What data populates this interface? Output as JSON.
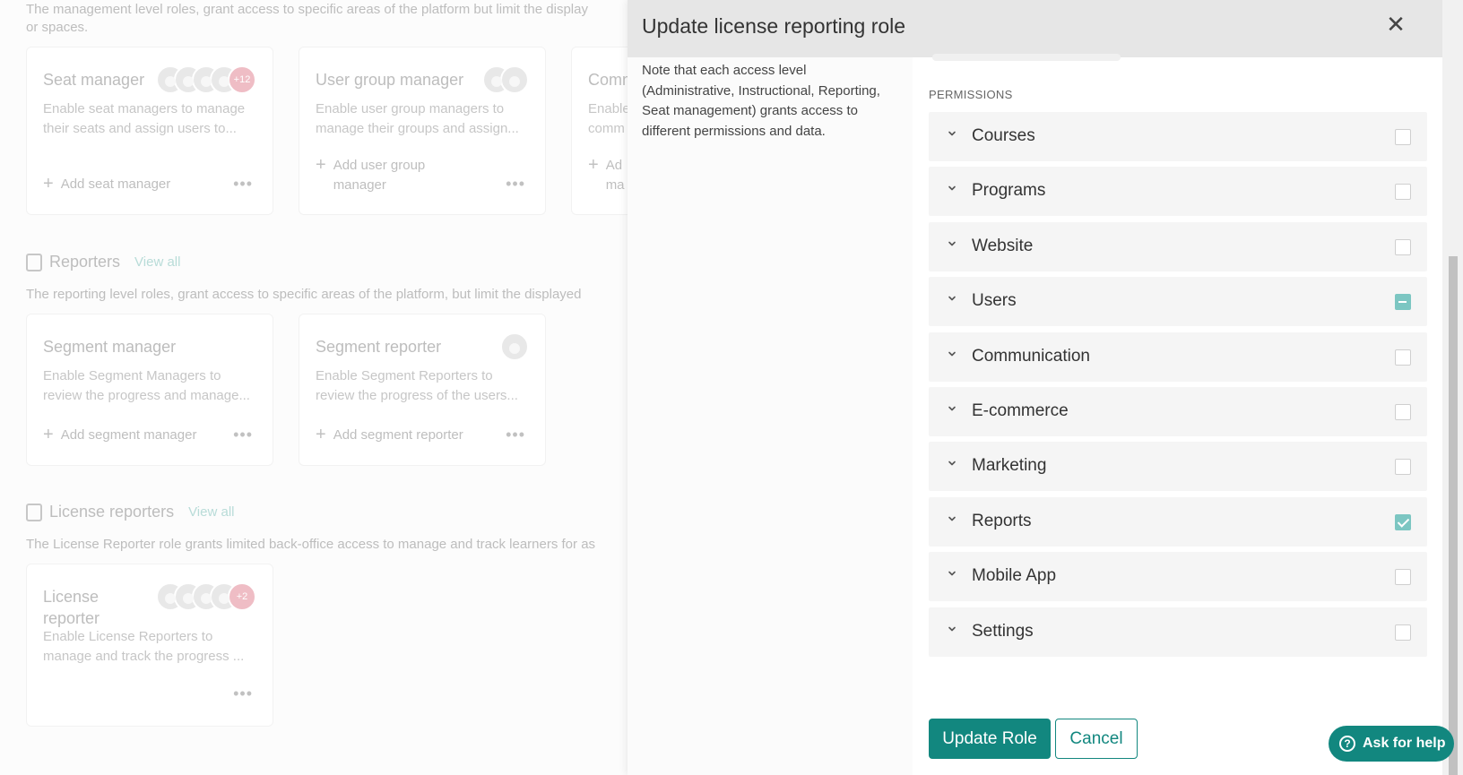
{
  "background": {
    "management_desc_line1": "The management level roles, grant access to specific areas of the platform but limit the display",
    "management_desc_line2": "or spaces.",
    "cards_row1": [
      {
        "title": "Seat manager",
        "text": "Enable seat managers to manage their seats and assign users to...",
        "add": "Add seat manager",
        "badge": "+12"
      },
      {
        "title": "User group manager",
        "text": "Enable user group managers to manage their groups and assign...",
        "add_line1": "Add user group",
        "add_line2": "manager"
      },
      {
        "title": "Comm",
        "text_line1": "Enable",
        "text_line2": "comm",
        "add_line1": "Ad",
        "add_line2": "ma"
      }
    ],
    "reporters": {
      "title": "Reporters",
      "link": "View all",
      "desc": "The reporting level roles, grant access to specific areas of the platform, but limit the displayed"
    },
    "cards_row2": [
      {
        "title": "Segment manager",
        "text": "Enable Segment Managers to review the progress and manage...",
        "add": "Add segment manager"
      },
      {
        "title": "Segment reporter",
        "text": "Enable Segment Reporters to review the progress of the users...",
        "add": "Add segment reporter"
      }
    ],
    "license_reporters": {
      "title": "License reporters",
      "link": "View all",
      "desc": "The License Reporter role grants limited back-office access to manage and track learners for as"
    },
    "cards_row3": [
      {
        "title_line1": "License",
        "title_line2": "reporter",
        "text": "Enable License Reporters to manage and track the progress ...",
        "badge": "+2"
      }
    ],
    "more": "•••"
  },
  "modal": {
    "title": "Update license reporting role",
    "close": "✕",
    "note": "Note that each access level (Administrative, Instructional, Reporting, Seat management) grants access to different permissions and data.",
    "permissions_heading": "PERMISSIONS",
    "permissions": [
      {
        "label": "Courses",
        "state": "unchecked"
      },
      {
        "label": "Programs",
        "state": "unchecked"
      },
      {
        "label": "Website",
        "state": "unchecked"
      },
      {
        "label": "Users",
        "state": "partial"
      },
      {
        "label": "Communication",
        "state": "unchecked"
      },
      {
        "label": "E-commerce",
        "state": "unchecked"
      },
      {
        "label": "Marketing",
        "state": "unchecked"
      },
      {
        "label": "Reports",
        "state": "checked"
      },
      {
        "label": "Mobile App",
        "state": "unchecked"
      },
      {
        "label": "Settings",
        "state": "unchecked"
      }
    ],
    "update_button": "Update Role",
    "cancel_button": "Cancel"
  },
  "help": {
    "label": "Ask for help",
    "icon": "?"
  },
  "colors": {
    "accent": "#12877f",
    "checkbox": "#7cc6c2",
    "badge": "#e79aa7"
  }
}
